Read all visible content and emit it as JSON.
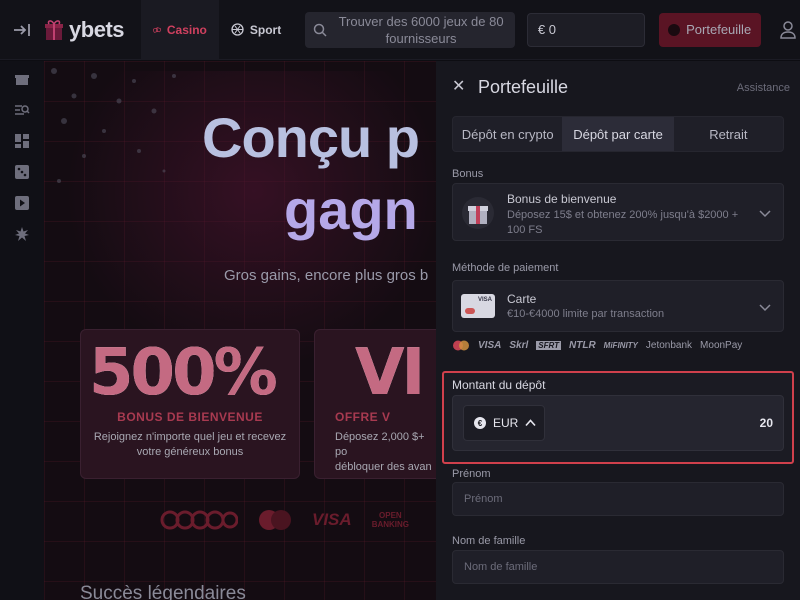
{
  "header": {
    "logo_text": "ybets",
    "nav": [
      {
        "label": "Casino"
      },
      {
        "label": "Sport"
      }
    ],
    "search_text": "Trouver des 6000 jeux de 80 fournisseurs",
    "balance": "€ 0",
    "wallet_button": "Portefeuille"
  },
  "promo": {
    "hero_line1": "Conçu p",
    "hero_line2": "gagn",
    "hero_sub": "Gros gains, encore plus gros b",
    "cards": [
      {
        "big": "500%",
        "label": "BONUS DE BIENVENUE",
        "desc": "Rejoignez n'importe quel jeu et recevez\nvotre généreux bonus"
      },
      {
        "big": "VI",
        "label": "OFFRE V",
        "desc": "Déposez 2,000 $+ po\ndébloquer des avan"
      }
    ],
    "pay_logos": [
      "VISA"
    ],
    "section_title": "Succès légendaires"
  },
  "panel": {
    "title": "Portefeuille",
    "assist": "Assistance",
    "tabs": [
      "Dépôt en crypto",
      "Dépôt par carte",
      "Retrait"
    ],
    "bonus_label": "Bonus",
    "bonus_title": "Bonus de bienvenue",
    "bonus_desc": "Déposez 15$ et obtenez 200% jusqu'à $2000 + 100 FS",
    "payment_label": "Méthode de paiement",
    "payment_title": "Carte",
    "payment_desc": "€10-€4000 limite par transaction",
    "visa_small": "VISA",
    "methods": [
      "VISA",
      "Skrl",
      "SFRT",
      "NTLR",
      "MiFINITY",
      "Jetonbank",
      "MoonPay"
    ],
    "deposit_label": "Montant du dépôt",
    "currency": "EUR",
    "amount": "20",
    "first_name_label": "Prénom",
    "first_name_placeholder": "Prénom",
    "last_name_label": "Nom de famille",
    "last_name_placeholder": "Nom de famille"
  },
  "colors": {
    "accent": "#d0405f",
    "highlight": "#d0404c",
    "panel_bg": "#17171e"
  }
}
